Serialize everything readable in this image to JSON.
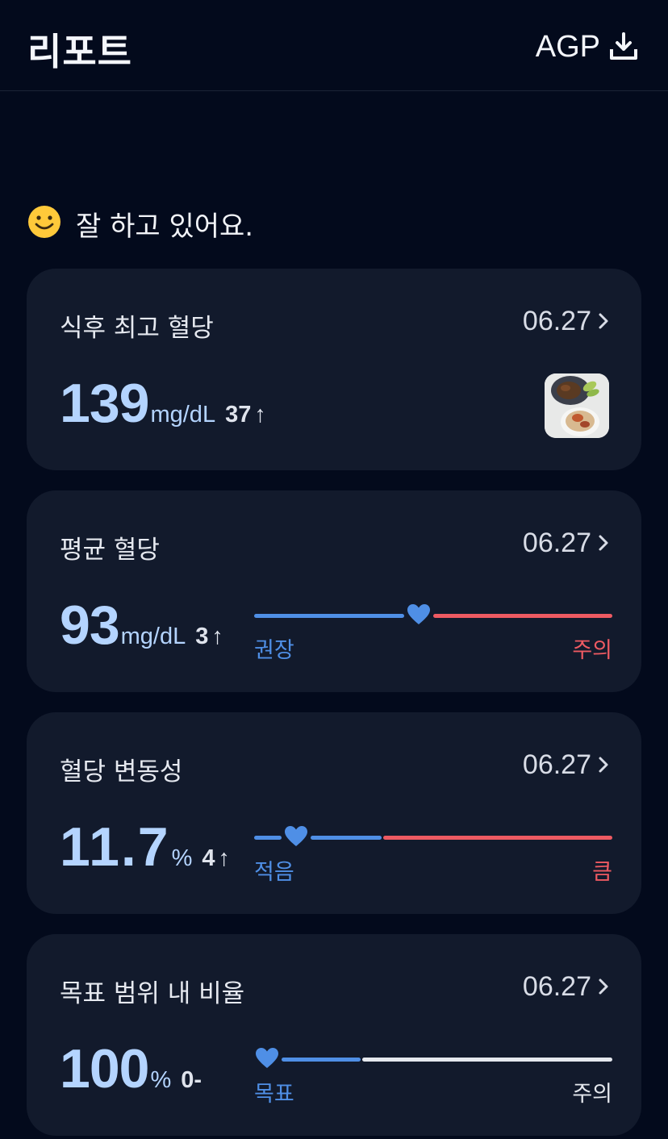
{
  "header": {
    "title": "리포트",
    "agp_label": "AGP",
    "download_icon": "download-icon"
  },
  "greeting": {
    "icon": "smiley-icon",
    "text": "잘 하고 있어요."
  },
  "colors": {
    "value": "#b4d4ff",
    "recommended": "#4f8fe6",
    "warning": "#ee5a62",
    "neutral": "#e5e8ee",
    "card_bg": "#121a2c",
    "page_bg": "#030a1c"
  },
  "cards": [
    {
      "label": "식후 최고 혈당",
      "date": "06.27",
      "value": "139",
      "unit": "mg/dL",
      "delta": "37",
      "arrow": "↑",
      "thumbnail": "meal-photo"
    },
    {
      "label": "평균 혈당",
      "date": "06.27",
      "value": "93",
      "unit": "mg/dL",
      "delta": "3",
      "arrow": "↑",
      "range_left": "권장",
      "range_right": "주의"
    },
    {
      "label": "혈당 변동성",
      "date": "06.27",
      "value": "11.7",
      "unit": "%",
      "delta": "4",
      "arrow": "↑",
      "range_left": "적음",
      "range_right": "큼"
    },
    {
      "label": "목표 범위 내 비율",
      "date": "06.27",
      "value": "100",
      "unit": "%",
      "delta": "0-",
      "range_left": "목표",
      "range_right": "주의"
    }
  ]
}
